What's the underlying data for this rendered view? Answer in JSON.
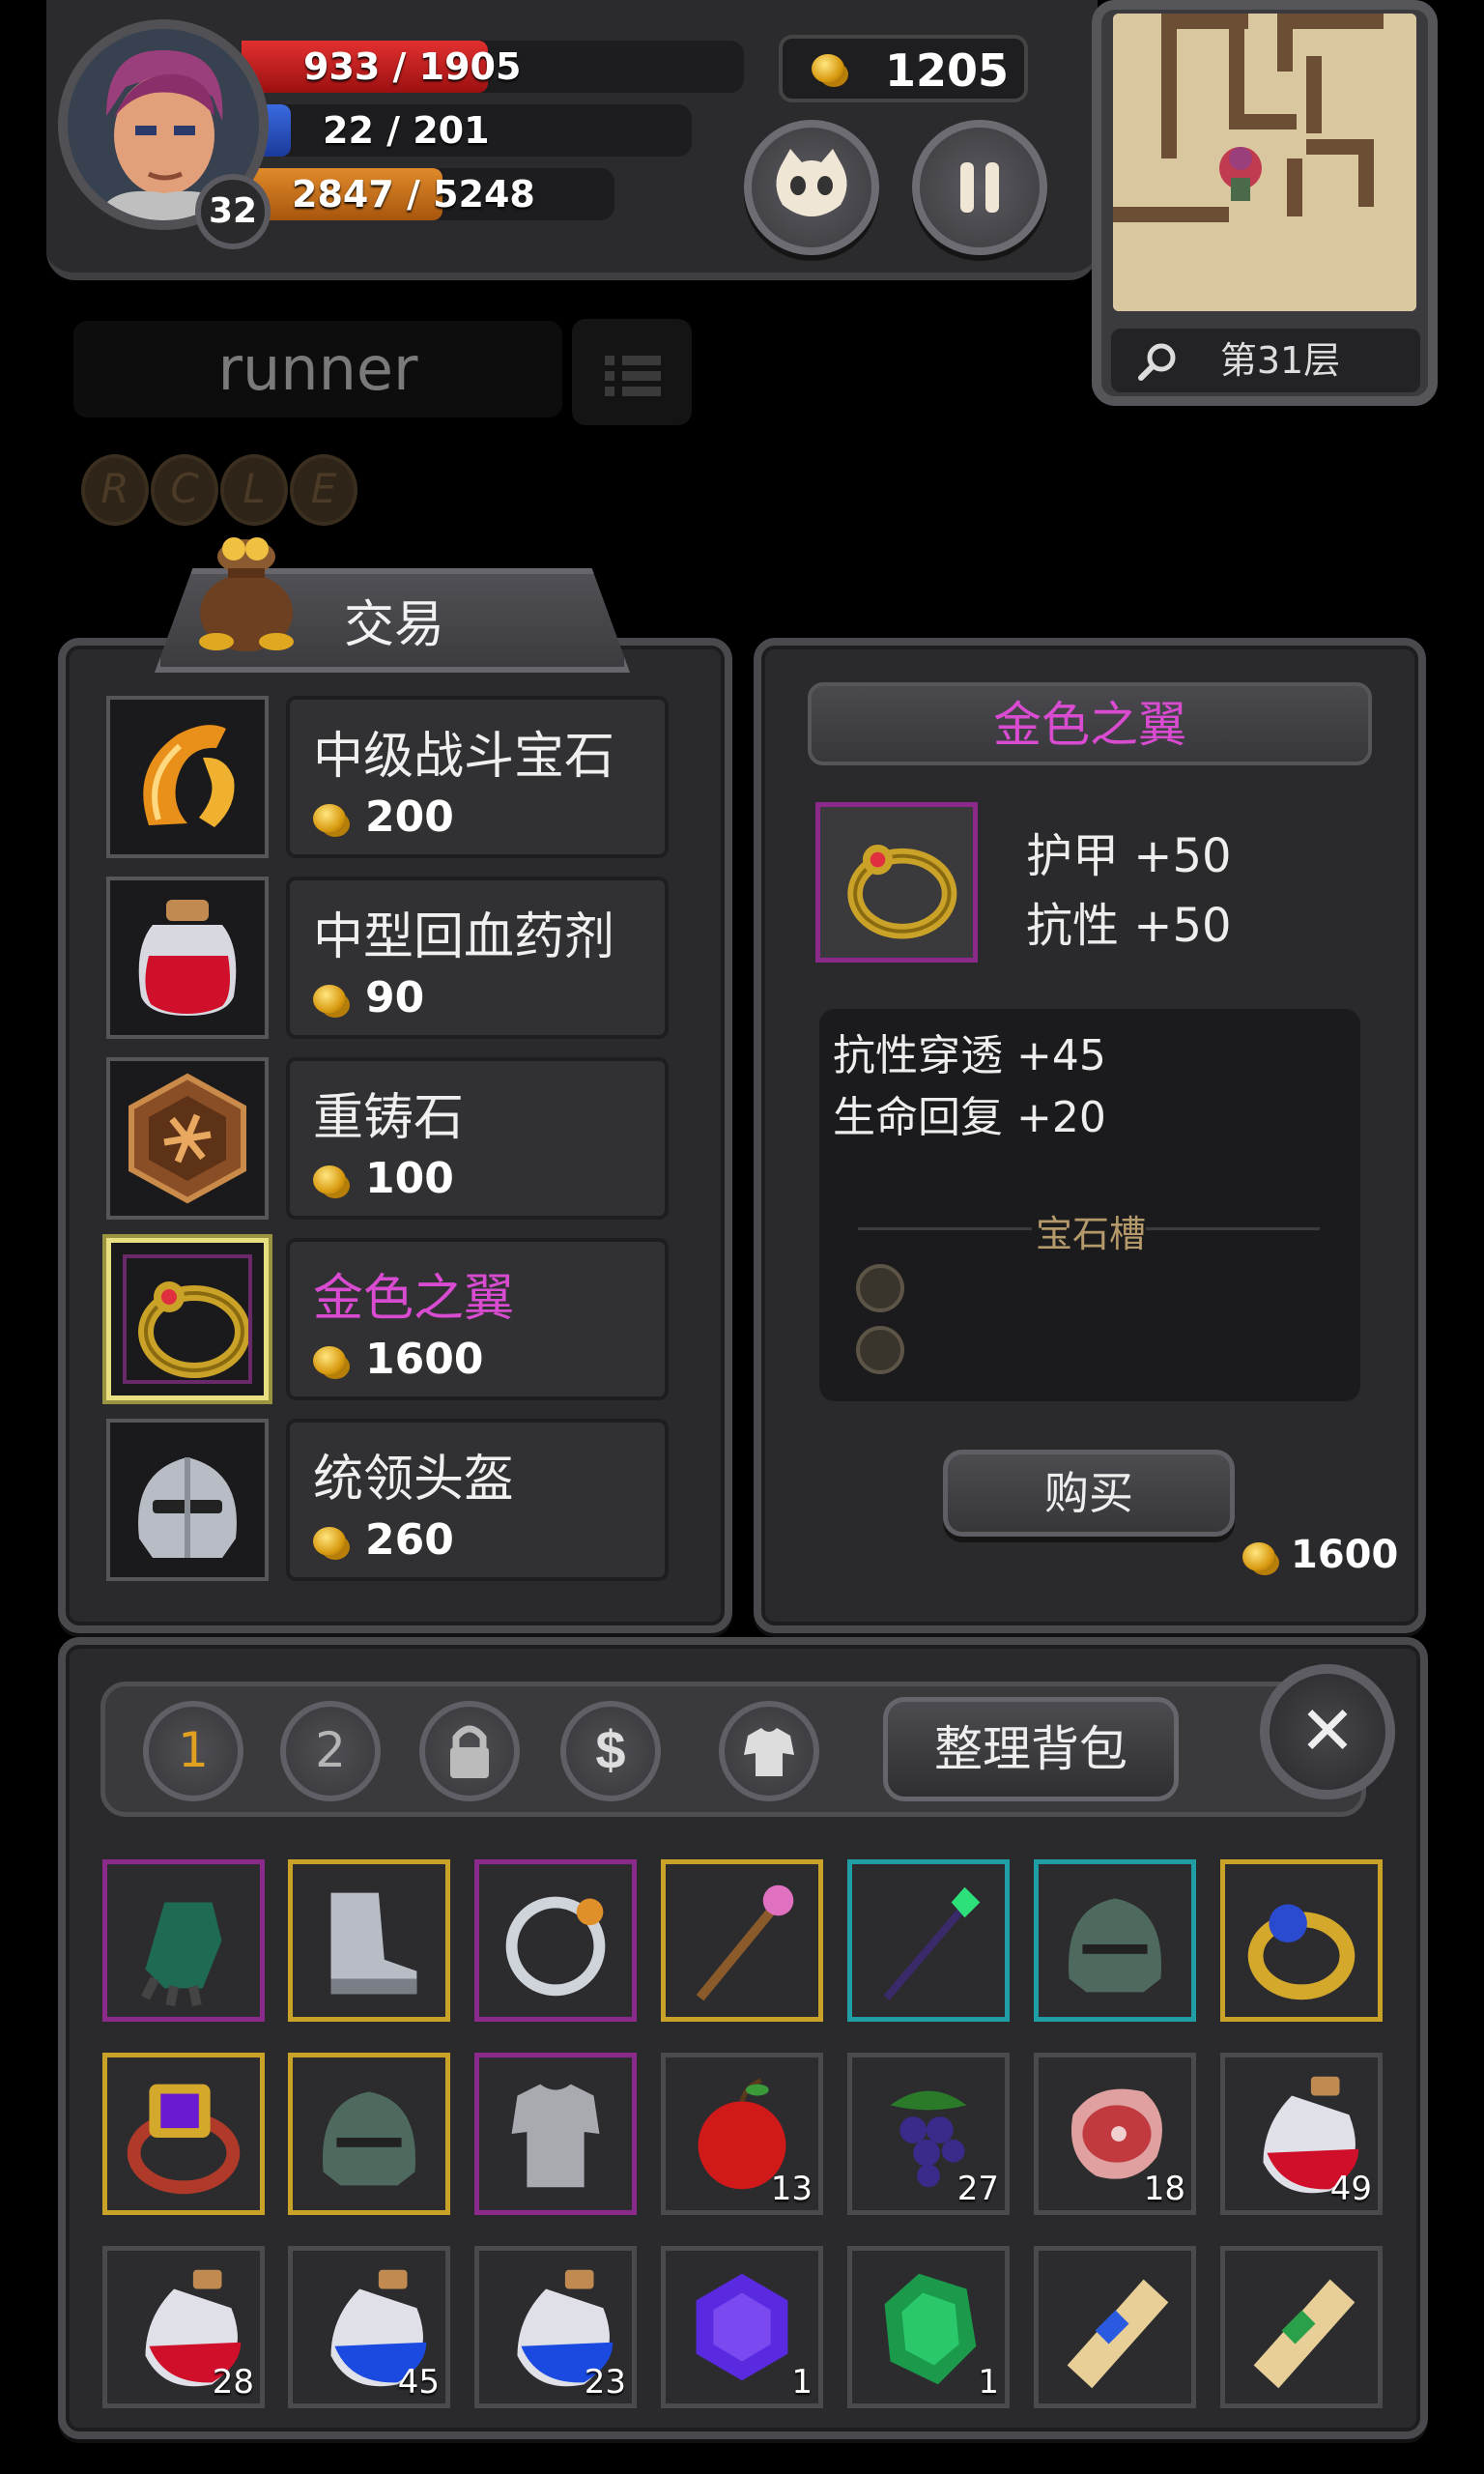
{
  "hud": {
    "hp_text": "933 / 1905",
    "hp_fraction": 0.49,
    "mp_text": "22 / 201",
    "mp_fraction": 0.11,
    "xp_text": "2847 / 5248",
    "xp_fraction": 0.54,
    "level": "32",
    "gold": "1205",
    "floor_label": "第31层"
  },
  "search": {
    "text": "runner"
  },
  "runes": [
    "R",
    "C",
    "L",
    "E"
  ],
  "trade": {
    "title": "交易",
    "items": [
      {
        "name": "中级战斗宝石",
        "price": "200",
        "icon": "combat-gem-icon",
        "name_color": "#f0f0f0"
      },
      {
        "name": "中型回血药剂",
        "price": "90",
        "icon": "health-potion-icon",
        "name_color": "#f0f0f0"
      },
      {
        "name": "重铸石",
        "price": "100",
        "icon": "reforge-stone-icon",
        "name_color": "#f0f0f0"
      },
      {
        "name": "金色之翼",
        "price": "1600",
        "icon": "gold-ring-icon",
        "name_color": "#d94bd0"
      },
      {
        "name": "统领头盔",
        "price": "260",
        "icon": "commander-helmet-icon",
        "name_color": "#f0f0f0"
      }
    ]
  },
  "detail": {
    "title": "金色之翼",
    "title_color": "#d94bd0",
    "main_stats": [
      "护甲 +50",
      "抗性 +50"
    ],
    "sub_stats": [
      "抗性穿透 +45",
      "生命回复 +20"
    ],
    "gem_slot_label": "宝石槽",
    "buy_label": "购买",
    "price": "1600"
  },
  "inventory": {
    "tabs": [
      "1",
      "2"
    ],
    "active_tab": "1",
    "sort_label": "整理背包",
    "close_label": "✕",
    "slots": [
      {
        "icon": "gauntlet-icon",
        "rarity": "epic",
        "qty": ""
      },
      {
        "icon": "boots-icon",
        "rarity": "legend",
        "qty": ""
      },
      {
        "icon": "silver-ring-icon",
        "rarity": "epic",
        "qty": ""
      },
      {
        "icon": "staff-icon",
        "rarity": "legend",
        "qty": ""
      },
      {
        "icon": "emerald-wand-icon",
        "rarity": "rare",
        "qty": ""
      },
      {
        "icon": "helmet-icon",
        "rarity": "rare",
        "qty": ""
      },
      {
        "icon": "sapphire-ring-icon",
        "rarity": "legend",
        "qty": ""
      },
      {
        "icon": "amethyst-ring-icon",
        "rarity": "legend",
        "qty": ""
      },
      {
        "icon": "helmet-icon",
        "rarity": "legend",
        "qty": ""
      },
      {
        "icon": "chest-armor-icon",
        "rarity": "epic",
        "qty": ""
      },
      {
        "icon": "apple-icon",
        "rarity": "common",
        "qty": "13"
      },
      {
        "icon": "grapes-icon",
        "rarity": "common",
        "qty": "27"
      },
      {
        "icon": "meat-icon",
        "rarity": "common",
        "qty": "18"
      },
      {
        "icon": "red-potion-icon",
        "rarity": "common",
        "qty": "49"
      },
      {
        "icon": "red-potion-icon",
        "rarity": "common",
        "qty": "28"
      },
      {
        "icon": "blue-potion-icon",
        "rarity": "common",
        "qty": "45"
      },
      {
        "icon": "blue-potion-icon",
        "rarity": "common",
        "qty": "23"
      },
      {
        "icon": "purple-gem-icon",
        "rarity": "common",
        "qty": "1"
      },
      {
        "icon": "green-gem-icon",
        "rarity": "common",
        "qty": "1"
      },
      {
        "icon": "scroll-blue-icon",
        "rarity": "common",
        "qty": ""
      },
      {
        "icon": "scroll-green-icon",
        "rarity": "common",
        "qty": ""
      }
    ]
  }
}
